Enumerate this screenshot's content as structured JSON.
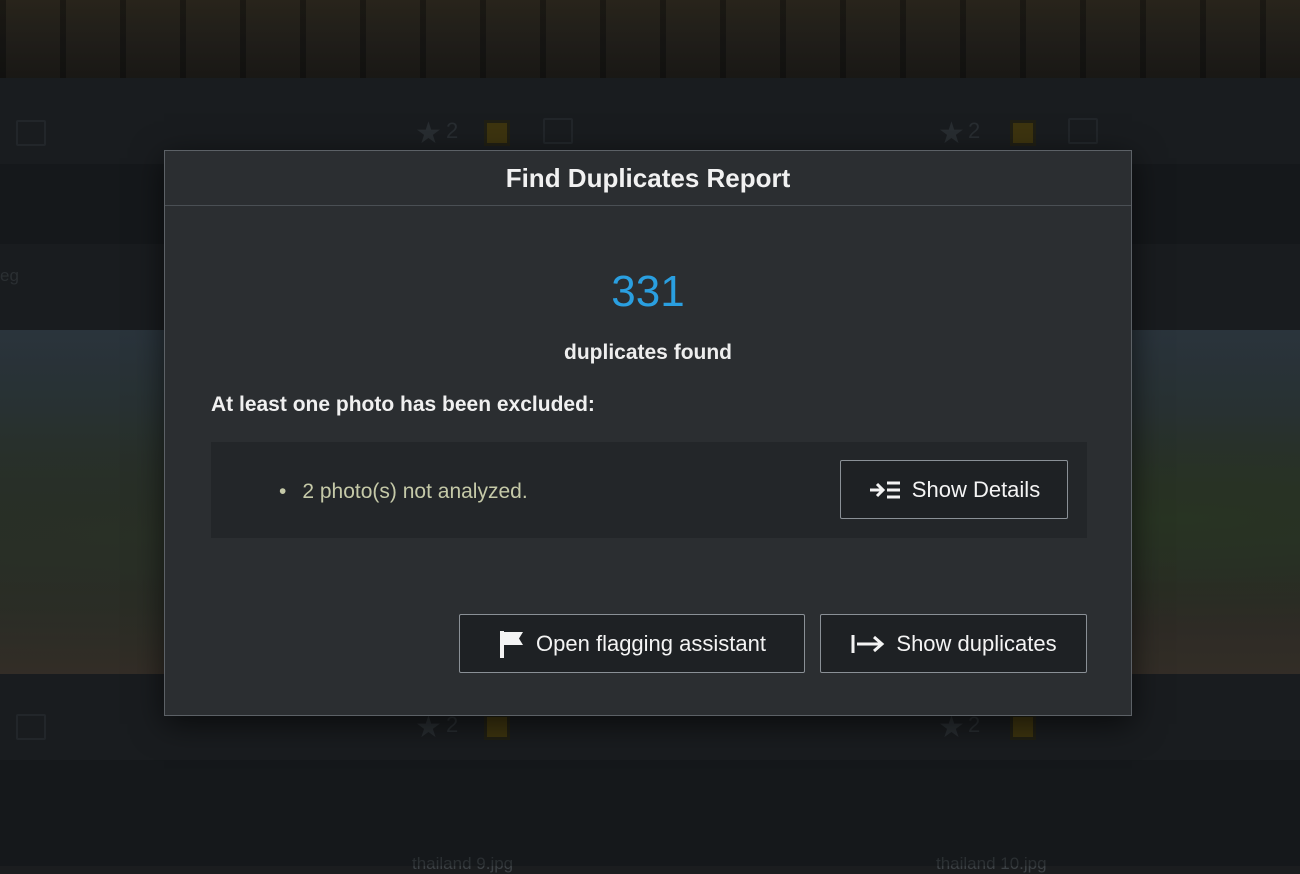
{
  "background": {
    "rating_left": "2",
    "rating_right": "2",
    "rating_bottom_left": "2",
    "rating_bottom_right": "2",
    "partial_file_text": "eg",
    "bottom_left_filename": "thailand 9.jpg",
    "bottom_right_filename": "thailand 10.jpg"
  },
  "dialog": {
    "title": "Find Duplicates Report",
    "count": "331",
    "count_label": "duplicates found",
    "excluded_heading": "At least one photo has been excluded:",
    "excluded_items": [
      "2 photo(s) not analyzed."
    ],
    "show_details_label": "Show Details",
    "open_flagging_label": "Open flagging assistant",
    "show_duplicates_label": "Show duplicates"
  },
  "colors": {
    "accent": "#2a9fe0",
    "dialog_bg": "#2b2e31",
    "excluded_text": "#c5c9a8"
  },
  "icons": {
    "show_details": "indent-list-icon",
    "open_flagging": "flag-icon",
    "show_duplicates": "arrow-to-right-icon"
  }
}
